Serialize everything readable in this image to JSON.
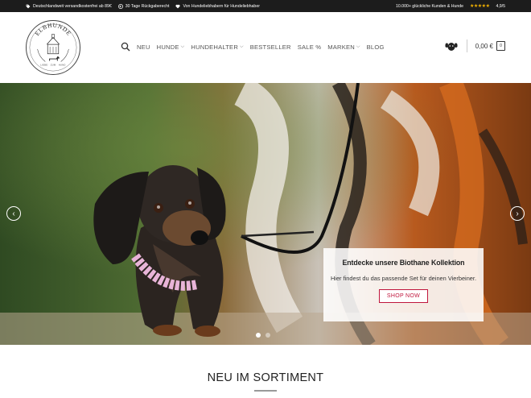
{
  "topbar": {
    "items": [
      {
        "icon": "tag-icon",
        "text": "Deutschlandweit versandkostenfrei ab 89€"
      },
      {
        "icon": "return-icon",
        "text": "30 Tage Rückgaberecht"
      },
      {
        "icon": "heart-icon",
        "text": "Von Hundeliebhabern für Hundeliebhaber"
      }
    ],
    "reviews_text": "10.000+ glückliche Kunden & Hunde",
    "stars": "★★★★★",
    "rating": "4,9/5"
  },
  "logo": {
    "brand_text": "ELBHUNDE",
    "tagline": "LIEBE · ZUM · HUND"
  },
  "nav": [
    {
      "label": "NEU",
      "dropdown": false
    },
    {
      "label": "HUNDE",
      "dropdown": true
    },
    {
      "label": "HUNDEHALTER",
      "dropdown": true
    },
    {
      "label": "BESTSELLER",
      "dropdown": false
    },
    {
      "label": "SALE %",
      "dropdown": false
    },
    {
      "label": "MARKEN",
      "dropdown": true
    },
    {
      "label": "BLOG",
      "dropdown": false
    }
  ],
  "cart": {
    "total": "0,00 €",
    "count": "0"
  },
  "hero": {
    "promo_title": "Entdecke unsere Biothane Kollektion",
    "promo_subtitle": "Hier findest du das passende Set für deinen Vierbeiner.",
    "button_label": "SHOP NOW",
    "slides": 2,
    "active_slide": 1
  },
  "section": {
    "title": "NEU IM SORTIMENT"
  },
  "colors": {
    "accent": "#c0163d",
    "topbar_bg": "#1c1c1c",
    "star": "#f5b301"
  }
}
